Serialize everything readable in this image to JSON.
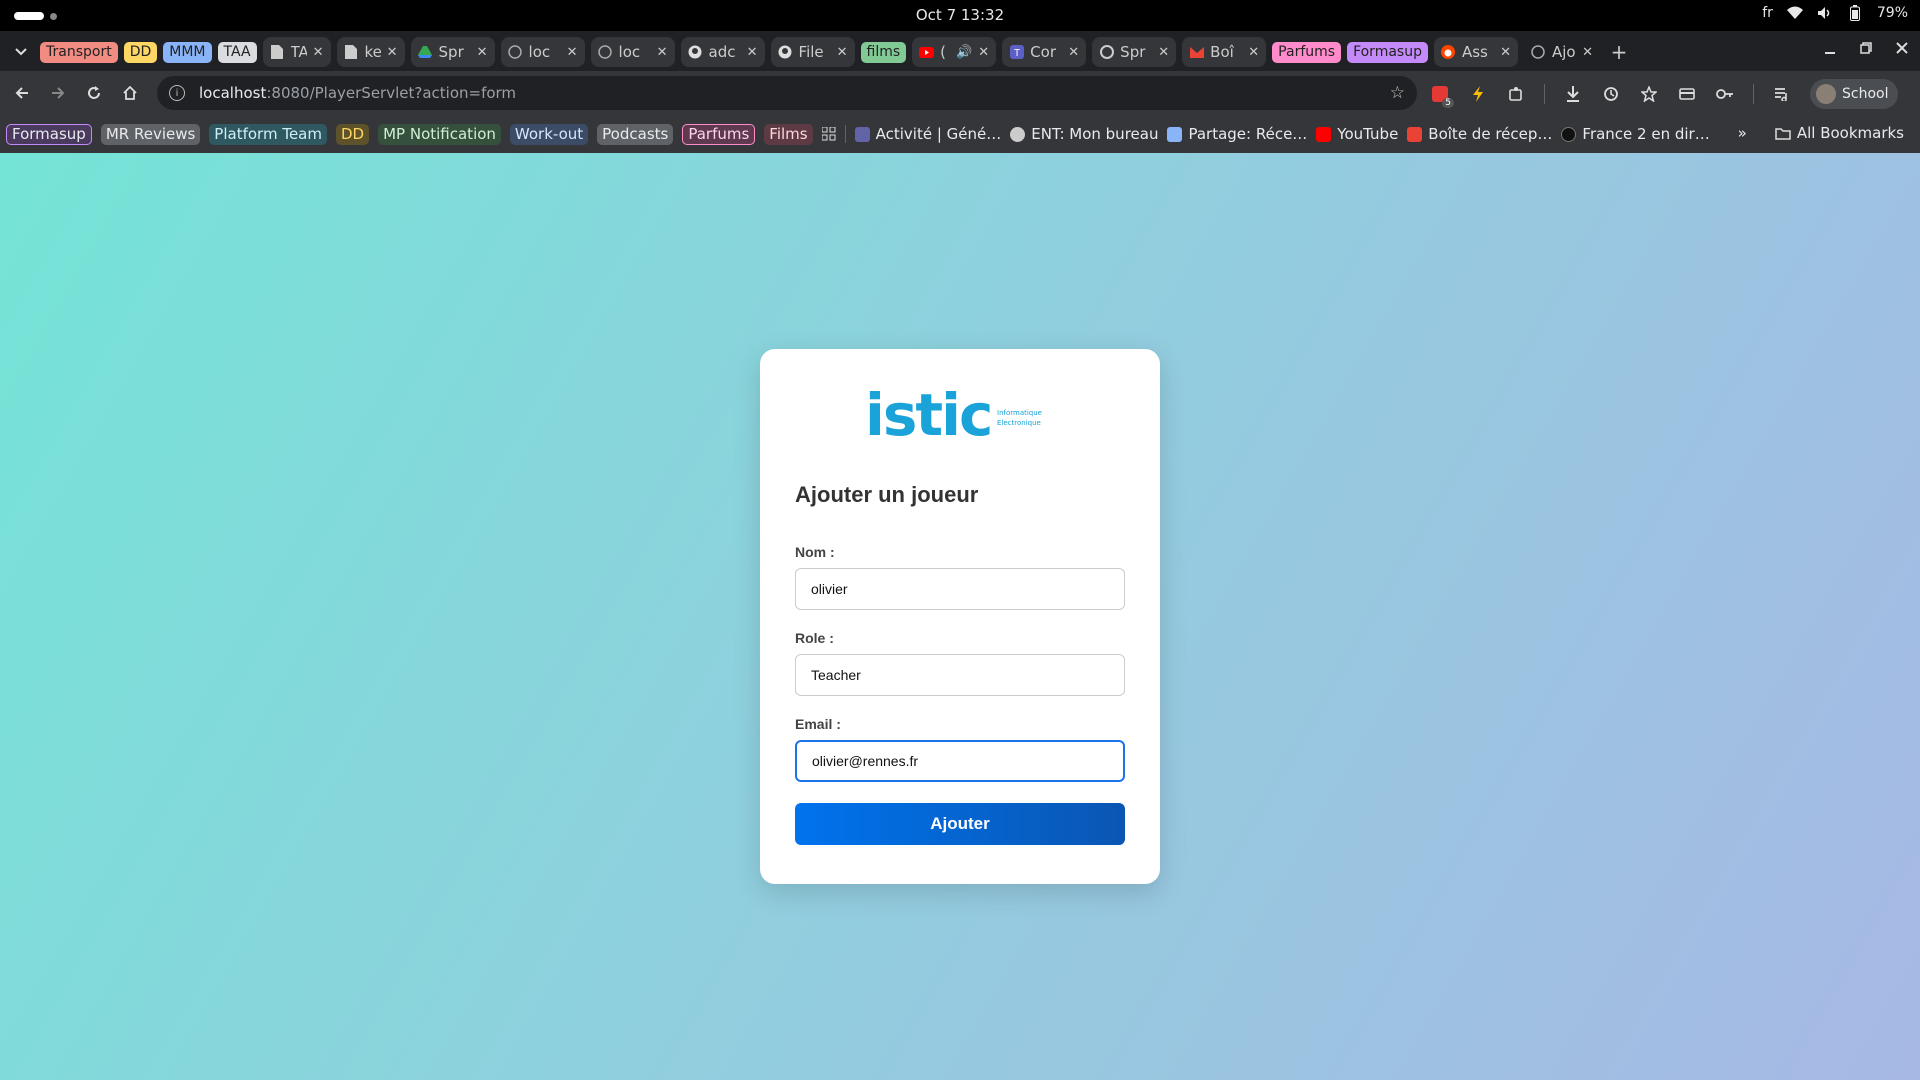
{
  "os": {
    "clock": "Oct 7  13:32",
    "language": "fr",
    "battery": "79%"
  },
  "tab_groups": {
    "transport": {
      "label": "Transport",
      "color": "#f28b82"
    },
    "dd": {
      "label": "DD",
      "color": "#fdd663"
    },
    "mmm": {
      "label": "MMM",
      "color": "#8ab4f8"
    },
    "taa": {
      "label": "TAA",
      "color": "#dadce0"
    },
    "films": {
      "label": "films",
      "color": "#81c995"
    },
    "parfums": {
      "label": "Parfums",
      "color": "#ff8bcb"
    },
    "formasup": {
      "label": "Formasup",
      "color": "#c58af9"
    }
  },
  "tabs": [
    {
      "title": "TA/",
      "icon": "doc-icon"
    },
    {
      "title": "key",
      "icon": "doc-icon"
    },
    {
      "title": "Spr",
      "icon": "drive-icon"
    },
    {
      "title": "loc",
      "icon": "globe-icon"
    },
    {
      "title": "loc",
      "icon": "globe-icon"
    },
    {
      "title": "adc",
      "icon": "github-icon"
    },
    {
      "title": "File",
      "icon": "github-icon"
    },
    {
      "title": "(",
      "icon": "youtube-icon"
    },
    {
      "title": "Cor",
      "icon": "teams-icon"
    },
    {
      "title": "Spr",
      "icon": "openai-icon"
    },
    {
      "title": "Boî",
      "icon": "gmail-icon"
    },
    {
      "title": "Ass",
      "icon": "reddit-icon"
    },
    {
      "title": "Ajo",
      "icon": "globe-icon"
    }
  ],
  "address_bar": {
    "host": "localhost",
    "rest": ":8080/PlayerServlet?action=form"
  },
  "profile": {
    "label": "School"
  },
  "extension_badge": "5",
  "bookmarks": {
    "groups": [
      {
        "label": "Formasup",
        "color": "#c58af9"
      },
      {
        "label": "MR Reviews",
        "color": "#dadce0"
      },
      {
        "label": "Platform Team",
        "color": "#78d9ec"
      },
      {
        "label": "DD",
        "color": "#fdd663"
      },
      {
        "label": "MP Notification",
        "color": "#81c995"
      },
      {
        "label": "Work-out",
        "color": "#8ab4f8"
      },
      {
        "label": "Podcasts",
        "color": "#dadce0"
      },
      {
        "label": "Parfums",
        "color": "#ff8bcb"
      },
      {
        "label": "Films",
        "color": "#f28b82"
      }
    ],
    "links": [
      {
        "label": "Activité | Géné…",
        "color": "#6264a7"
      },
      {
        "label": "ENT: Mon bureau",
        "color": "#cccccc"
      },
      {
        "label": "Partage: Réce…",
        "color": "#8ab4f8"
      },
      {
        "label": "YouTube",
        "color": "#ff0000"
      },
      {
        "label": "Boîte de récep…",
        "color": "#ea4335"
      },
      {
        "label": "France 2 en dir…",
        "color": "#222222"
      }
    ],
    "all_bookmarks": "All Bookmarks"
  },
  "form": {
    "logo_text": "istic",
    "logo_sub1": "Informatique",
    "logo_sub2": "Electronique",
    "title": "Ajouter un joueur",
    "nom_label": "Nom :",
    "nom_value": "olivier",
    "role_label": "Role :",
    "role_value": "Teacher",
    "email_label": "Email :",
    "email_value": "olivier@rennes.fr",
    "submit_label": "Ajouter"
  },
  "colors": {
    "accent": "#0073ee",
    "logo": "#1aa3d9"
  }
}
